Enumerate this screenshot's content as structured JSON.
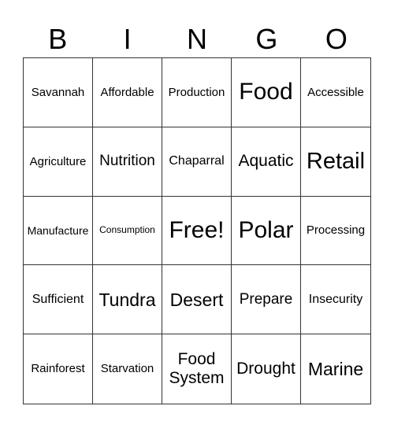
{
  "header": [
    "B",
    "I",
    "N",
    "G",
    "O"
  ],
  "cells": [
    "Savannah",
    "Affordable",
    "Production",
    "Food",
    "Accessible",
    "Agriculture",
    "Nutrition",
    "Chaparral",
    "Aquatic",
    "Retail",
    "Manufacture",
    "Consumption",
    "Free!",
    "Polar",
    "Processing",
    "Sufficient",
    "Tundra",
    "Desert",
    "Prepare",
    "Insecurity",
    "Rainforest",
    "Starvation",
    "Food System",
    "Drought",
    "Marine"
  ]
}
